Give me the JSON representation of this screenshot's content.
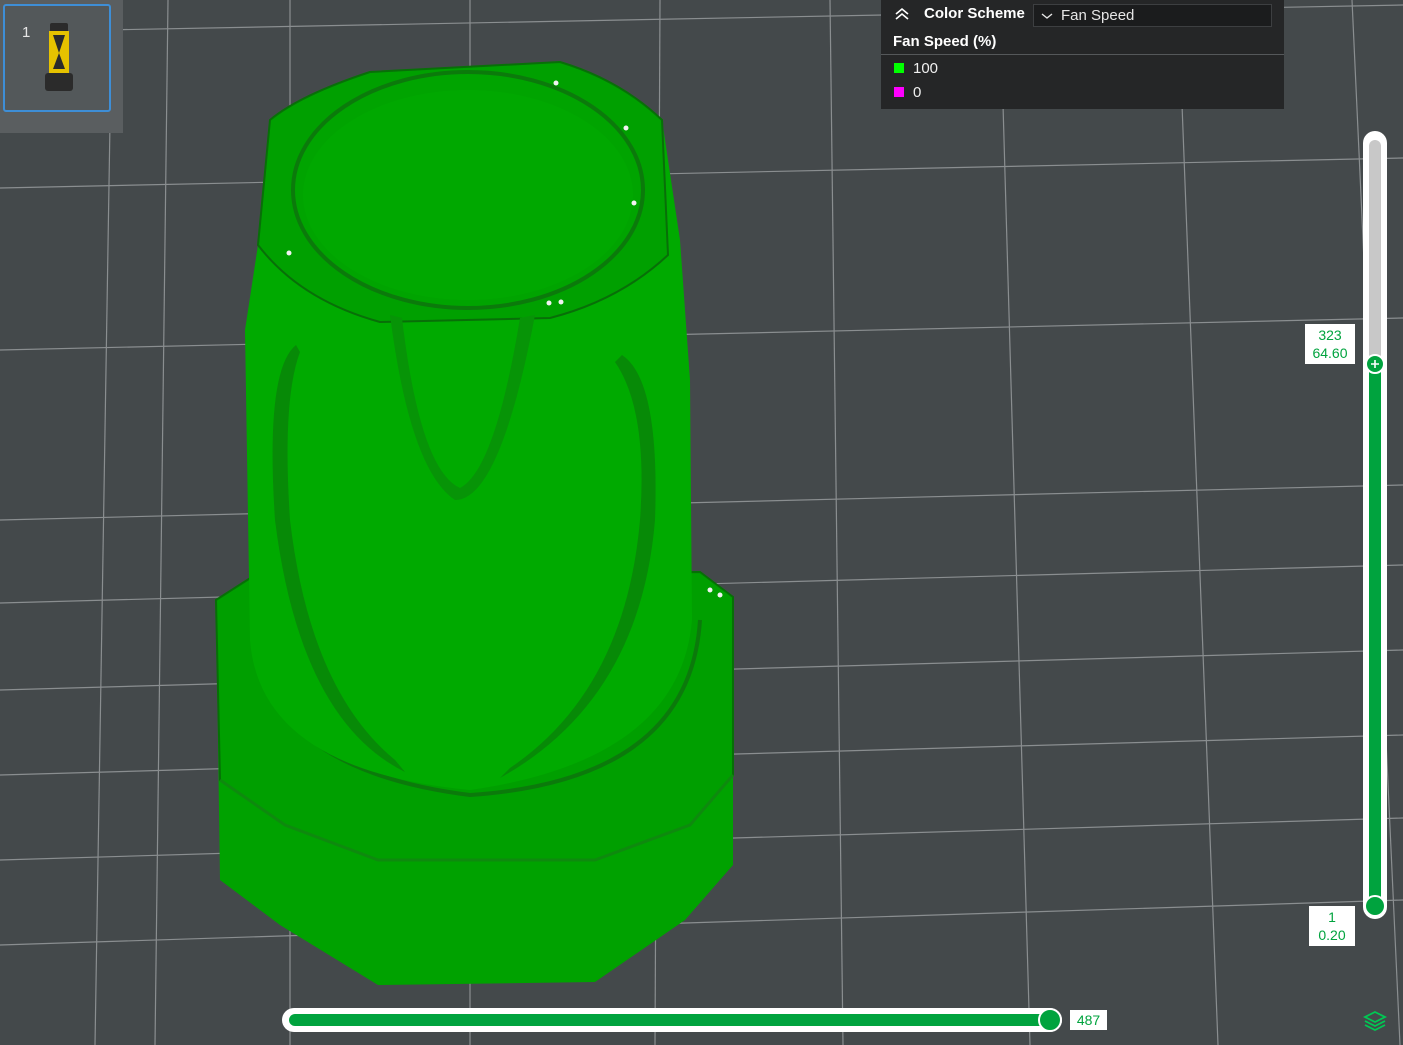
{
  "colors": {
    "background": "#44494b",
    "grid": "#8a8e90",
    "model_green": "#00a300",
    "accent": "#00a33e",
    "panel": "#252627",
    "selection_border": "#3e8ed6"
  },
  "thumbnail": {
    "index": "1"
  },
  "color_scheme": {
    "label": "Color Scheme",
    "selected": "Fan Speed",
    "collapse_icon": "chevron-up-double-icon",
    "dropdown_icon": "chevron-down-icon"
  },
  "legend": {
    "title": "Fan Speed (%)",
    "items": [
      {
        "label": "100",
        "color": "#00ff00"
      },
      {
        "label": "0",
        "color": "#ff00ff"
      }
    ]
  },
  "layer_slider": {
    "top_layer": "323",
    "top_height": "64.60",
    "bottom_layer": "1",
    "bottom_height": "0.20"
  },
  "move_slider": {
    "value": "487"
  },
  "icons": {
    "layers": "layers-icon",
    "top_handle": "plus-icon"
  }
}
